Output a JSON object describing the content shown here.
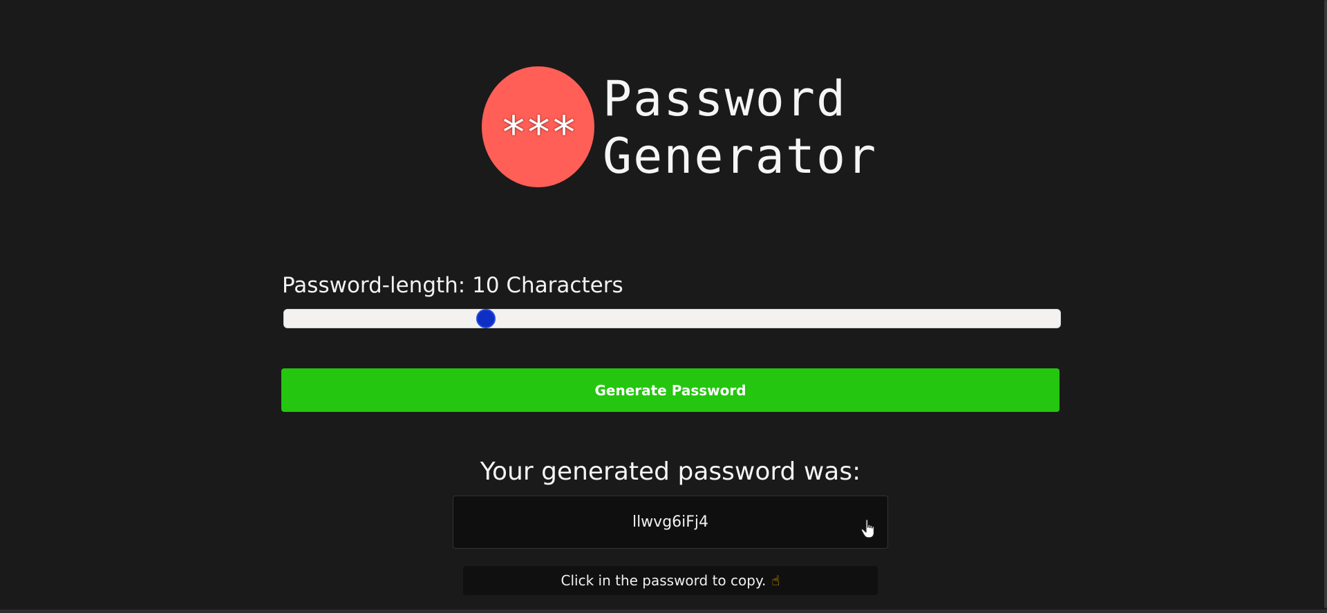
{
  "header": {
    "logo_text": "***",
    "title_line1": "Password",
    "title_line2": "Generator",
    "logo_color": "#ff5f56"
  },
  "length_control": {
    "label": "Password-length: 10 Characters",
    "value": 10,
    "fill_fraction": 0.26,
    "thumb_color": "#0d2fc4"
  },
  "generate_button": {
    "label": "Generate Password",
    "color": "#24c60f"
  },
  "result": {
    "heading": "Your generated password was:",
    "password": "llwvg6iFj4",
    "cursor_icon": "hand-pointer-icon"
  },
  "hint": {
    "text": "Click in the password to copy.",
    "emoji": "☝"
  }
}
